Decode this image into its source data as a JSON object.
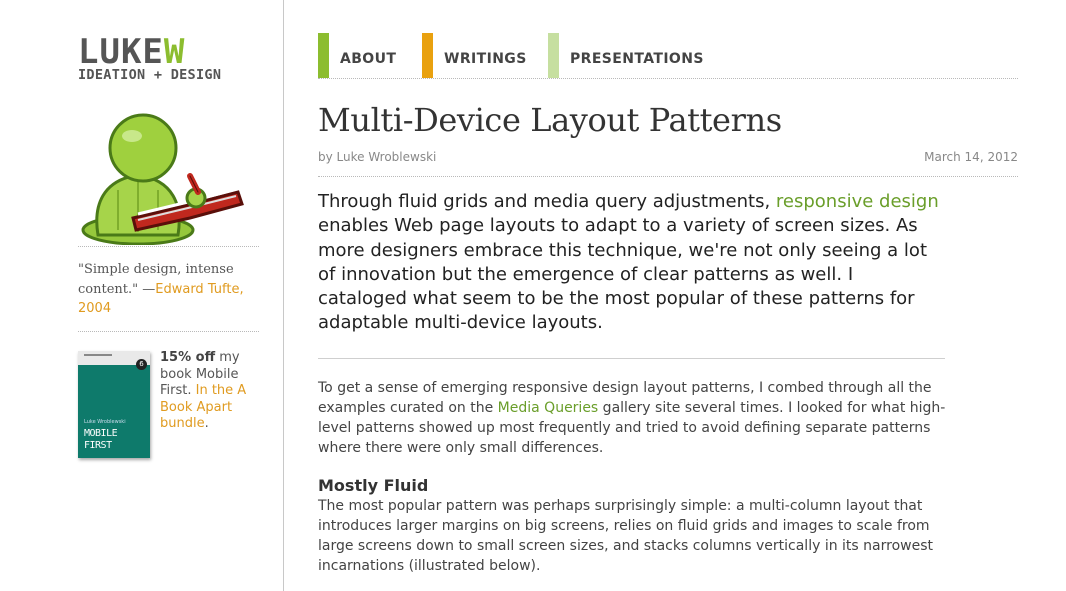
{
  "logo": {
    "word_main": "LUKE",
    "word_accent": "W",
    "tagline": "IDEATION + DESIGN"
  },
  "sidebar": {
    "quote_text": "\"Simple design, intense content.\" —",
    "quote_author": "Edward Tufte, 2004",
    "book": {
      "title": "MOBILE FIRST",
      "author": "Luke Wroblewski",
      "number": "6"
    },
    "promo": {
      "percent": "15% off",
      "text_a": " my book Mobile First. ",
      "link": "In the A Book Apart bundle",
      "end": "."
    }
  },
  "nav": {
    "items": [
      {
        "label": "ABOUT",
        "color": "#8cbd2f"
      },
      {
        "label": "WRITINGS",
        "color": "#e9a10f"
      },
      {
        "label": "PRESENTATIONS",
        "color": "#c6dfa0"
      }
    ]
  },
  "article": {
    "title": "Multi-Device Layout Patterns",
    "byline": "by Luke Wroblewski",
    "date": "March 14, 2012",
    "intro_a": "Through fluid grids and media query adjustments, ",
    "intro_link": "responsive design",
    "intro_b": " enables Web page layouts to adapt to a variety of screen sizes. As more designers embrace this technique, we're not only seeing a lot of innovation but the emergence of clear patterns as well. I cataloged what seem to be the most popular of these patterns for adaptable multi-device layouts.",
    "p1_a": "To get a sense of emerging responsive design layout patterns, I combed through all the examples curated on the ",
    "p1_link": "Media Queries",
    "p1_b": " gallery site several times. I looked for what high-level patterns showed up most frequently and tried to avoid defining separate patterns where there were only small differences.",
    "h3": "Mostly Fluid",
    "p2": "The most popular pattern was perhaps surprisingly simple: a multi-column layout that introduces larger margins on big screens, relies on fluid grids and images to scale from large screens down to small screen sizes, and stacks columns vertically in its narrowest incarnations (illustrated below)."
  }
}
